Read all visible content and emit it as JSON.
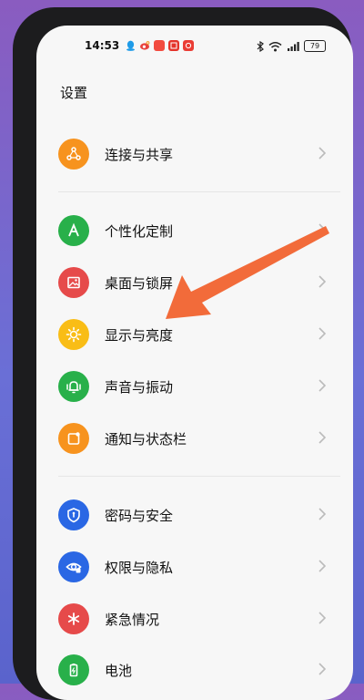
{
  "status_bar": {
    "time": "14:53",
    "battery": "79",
    "app_icons": [
      "qq-icon",
      "weibo-icon",
      "app-red-icon",
      "app-red-icon-2",
      "app-red-icon-3"
    ]
  },
  "page": {
    "title": "设置"
  },
  "groups": [
    {
      "items": [
        {
          "label": "连接与共享",
          "icon": "share-connect-icon",
          "color": "#f7931e"
        }
      ]
    },
    {
      "items": [
        {
          "label": "个性化定制",
          "icon": "personalize-icon",
          "color": "#28b04a"
        },
        {
          "label": "桌面与锁屏",
          "icon": "wallpaper-icon",
          "color": "#e64a4a"
        },
        {
          "label": "显示与亮度",
          "icon": "brightness-icon",
          "color": "#f9bd16"
        },
        {
          "label": "声音与振动",
          "icon": "bell-icon",
          "color": "#28b04a"
        },
        {
          "label": "通知与状态栏",
          "icon": "notification-icon",
          "color": "#f7931e"
        }
      ]
    },
    {
      "items": [
        {
          "label": "密码与安全",
          "icon": "shield-icon",
          "color": "#2a67e4"
        },
        {
          "label": "权限与隐私",
          "icon": "privacy-icon",
          "color": "#2a67e4"
        },
        {
          "label": "紧急情况",
          "icon": "emergency-icon",
          "color": "#e64a4a"
        },
        {
          "label": "电池",
          "icon": "battery-icon",
          "color": "#28b04a"
        }
      ]
    }
  ],
  "annotation": {
    "arrow_color": "#f26b3a"
  }
}
